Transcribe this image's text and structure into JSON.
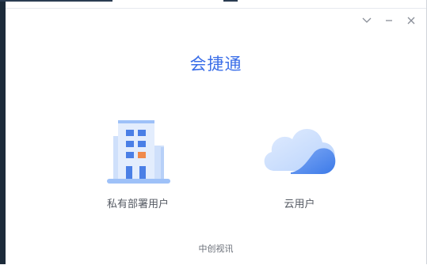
{
  "window": {
    "controls": [
      "collapse",
      "minimize",
      "close"
    ]
  },
  "app_title": "会捷通",
  "options": [
    {
      "label": "私有部署用户",
      "icon": "building-icon"
    },
    {
      "label": "云用户",
      "icon": "cloud-icon"
    }
  ],
  "footer": "中创视讯",
  "colors": {
    "accent": "#3a6ee8",
    "building_light": "#cfe0fb",
    "building_mid": "#4a7fe6",
    "building_orange": "#f08a4b",
    "cloud_light": "#c7dcfd",
    "cloud_dark": "#4a86f0"
  }
}
